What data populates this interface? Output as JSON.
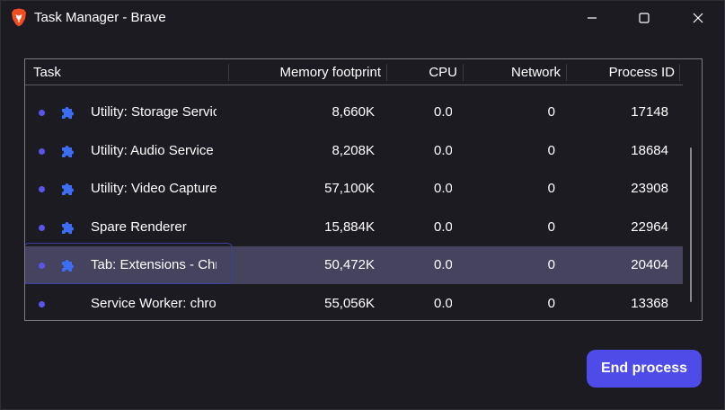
{
  "window": {
    "title": "Task Manager - Brave",
    "icons": {
      "app": "brave-lion-icon",
      "minimize": "minimize-icon",
      "maximize": "maximize-icon",
      "close": "close-icon"
    }
  },
  "table": {
    "headers": {
      "task": "Task",
      "memory": "Memory footprint",
      "cpu": "CPU",
      "network": "Network",
      "pid": "Process ID"
    },
    "rows": [
      {
        "task": "Utility: Storage Service",
        "memory": "8,660K",
        "cpu": "0.0",
        "network": "0",
        "pid": "17148",
        "icon": "puzzle-icon",
        "selected": false
      },
      {
        "task": "Utility: Audio Service",
        "memory": "8,208K",
        "cpu": "0.0",
        "network": "0",
        "pid": "18684",
        "icon": "puzzle-icon",
        "selected": false
      },
      {
        "task": "Utility: Video Capture",
        "memory": "57,100K",
        "cpu": "0.0",
        "network": "0",
        "pid": "23908",
        "icon": "puzzle-icon",
        "selected": false
      },
      {
        "task": "Spare Renderer",
        "memory": "15,884K",
        "cpu": "0.0",
        "network": "0",
        "pid": "22964",
        "icon": "puzzle-icon",
        "selected": false
      },
      {
        "task": "Tab: Extensions - Chrome",
        "memory": "50,472K",
        "cpu": "0.0",
        "network": "0",
        "pid": "20404",
        "icon": "puzzle-icon",
        "selected": true
      },
      {
        "task": "Service Worker: chrome",
        "memory": "55,056K",
        "cpu": "0.0",
        "network": "0",
        "pid": "13368",
        "icon": "",
        "selected": false
      }
    ]
  },
  "actions": {
    "end_process_label": "End process"
  },
  "colors": {
    "background": "#1c1b22",
    "selected_row": "#45435e",
    "accent": "#4f4be8",
    "status_dot": "#5a55e8",
    "puzzle_icon": "#3d6cf5"
  }
}
